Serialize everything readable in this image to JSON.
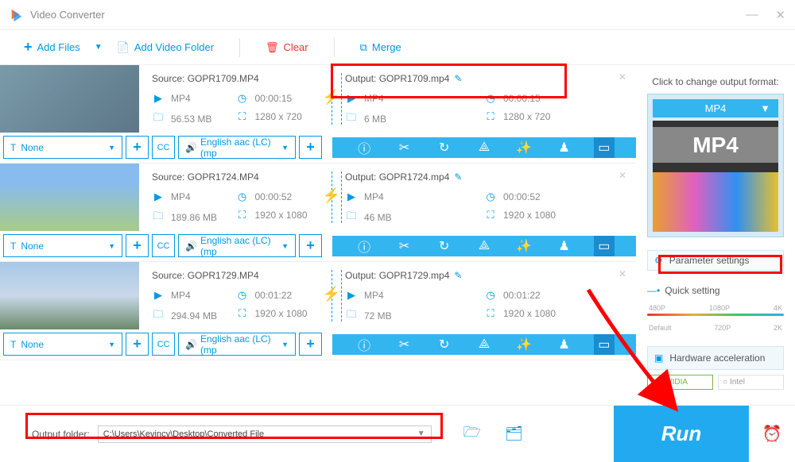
{
  "app_title": "Video Converter",
  "toolbar": {
    "add_files": "Add Files",
    "add_folder": "Add Video Folder",
    "clear": "Clear",
    "merge": "Merge"
  },
  "files": [
    {
      "source_label": "Source: GOPR1709.MP4",
      "src_format": "MP4",
      "src_duration": "00:00:15",
      "src_size": "56.53 MB",
      "src_res": "1280 x 720",
      "output_label": "Output: GOPR1709.mp4",
      "out_format": "MP4",
      "out_duration": "00:00:15",
      "out_size": "6 MB",
      "out_res": "1280 x 720"
    },
    {
      "source_label": "Source: GOPR1724.MP4",
      "src_format": "MP4",
      "src_duration": "00:00:52",
      "src_size": "189.86 MB",
      "src_res": "1920 x 1080",
      "output_label": "Output: GOPR1724.mp4",
      "out_format": "MP4",
      "out_duration": "00:00:52",
      "out_size": "46 MB",
      "out_res": "1920 x 1080"
    },
    {
      "source_label": "Source: GOPR1729.MP4",
      "src_format": "MP4",
      "src_duration": "00:01:22",
      "src_size": "294.94 MB",
      "src_res": "1920 x 1080",
      "output_label": "Output: GOPR1729.mp4",
      "out_format": "MP4",
      "out_duration": "00:01:22",
      "out_size": "72 MB",
      "out_res": "1920 x 1080"
    }
  ],
  "controls": {
    "subtitle_label": "None",
    "cc_label": "CC",
    "audio_label": "English aac (LC) (mp"
  },
  "sidebar": {
    "click_title": "Click to change output format:",
    "format": "MP4",
    "mp4_badge": "MP4",
    "param_settings": "Parameter settings",
    "quick_setting": "Quick setting",
    "labels_top": [
      "480P",
      "1080P",
      "4K"
    ],
    "labels_bot": [
      "Default",
      "720P",
      "2K"
    ],
    "hw_accel": "Hardware acceleration",
    "nvidia": "NVIDIA",
    "intel": "Intel"
  },
  "output": {
    "label": "Output folder:",
    "path": "C:\\Users\\Kevincy\\Desktop\\Converted File"
  },
  "run_label": "Run"
}
